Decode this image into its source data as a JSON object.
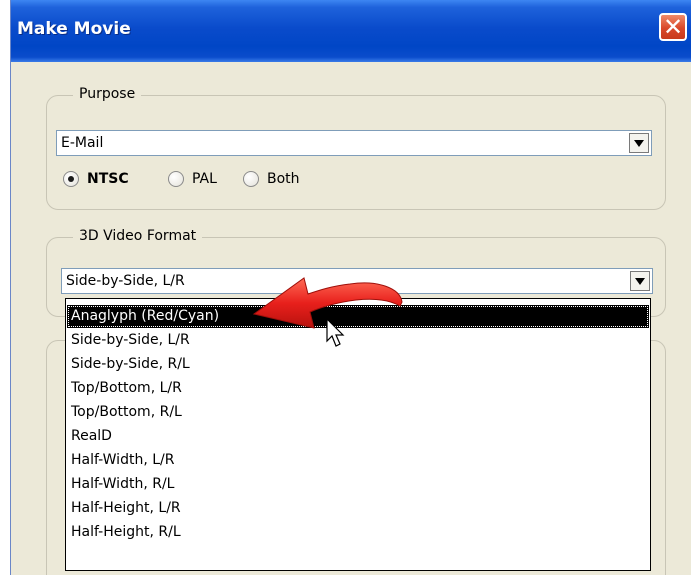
{
  "window": {
    "title": "Make Movie",
    "close_glyph": "✕"
  },
  "purpose": {
    "legend": "Purpose",
    "selected": "E-Mail",
    "radios": [
      {
        "label": "NTSC",
        "checked": true
      },
      {
        "label": "PAL",
        "checked": false
      },
      {
        "label": "Both",
        "checked": false
      }
    ]
  },
  "video_format": {
    "legend": "3D Video Format",
    "selected": "Side-by-Side, L/R",
    "options": [
      "Anaglyph (Red/Cyan)",
      "Side-by-Side, L/R",
      "Side-by-Side, R/L",
      "Top/Bottom, L/R",
      "Top/Bottom, R/L",
      "RealD",
      "Half-Width, L/R",
      "Half-Width, R/L",
      "Half-Height, L/R",
      "Half-Height, R/L"
    ],
    "highlighted_index": 0
  },
  "icons": {
    "close": "close-icon",
    "dropdown": "chevron-down-icon",
    "annotation": "red-arrow-icon",
    "cursor": "mouse-pointer-icon"
  },
  "colors": {
    "titlebar": "#0A4BCB",
    "window_bg": "#ECE9D8",
    "arrow": "#E8201C",
    "selection_bg": "#000000"
  }
}
